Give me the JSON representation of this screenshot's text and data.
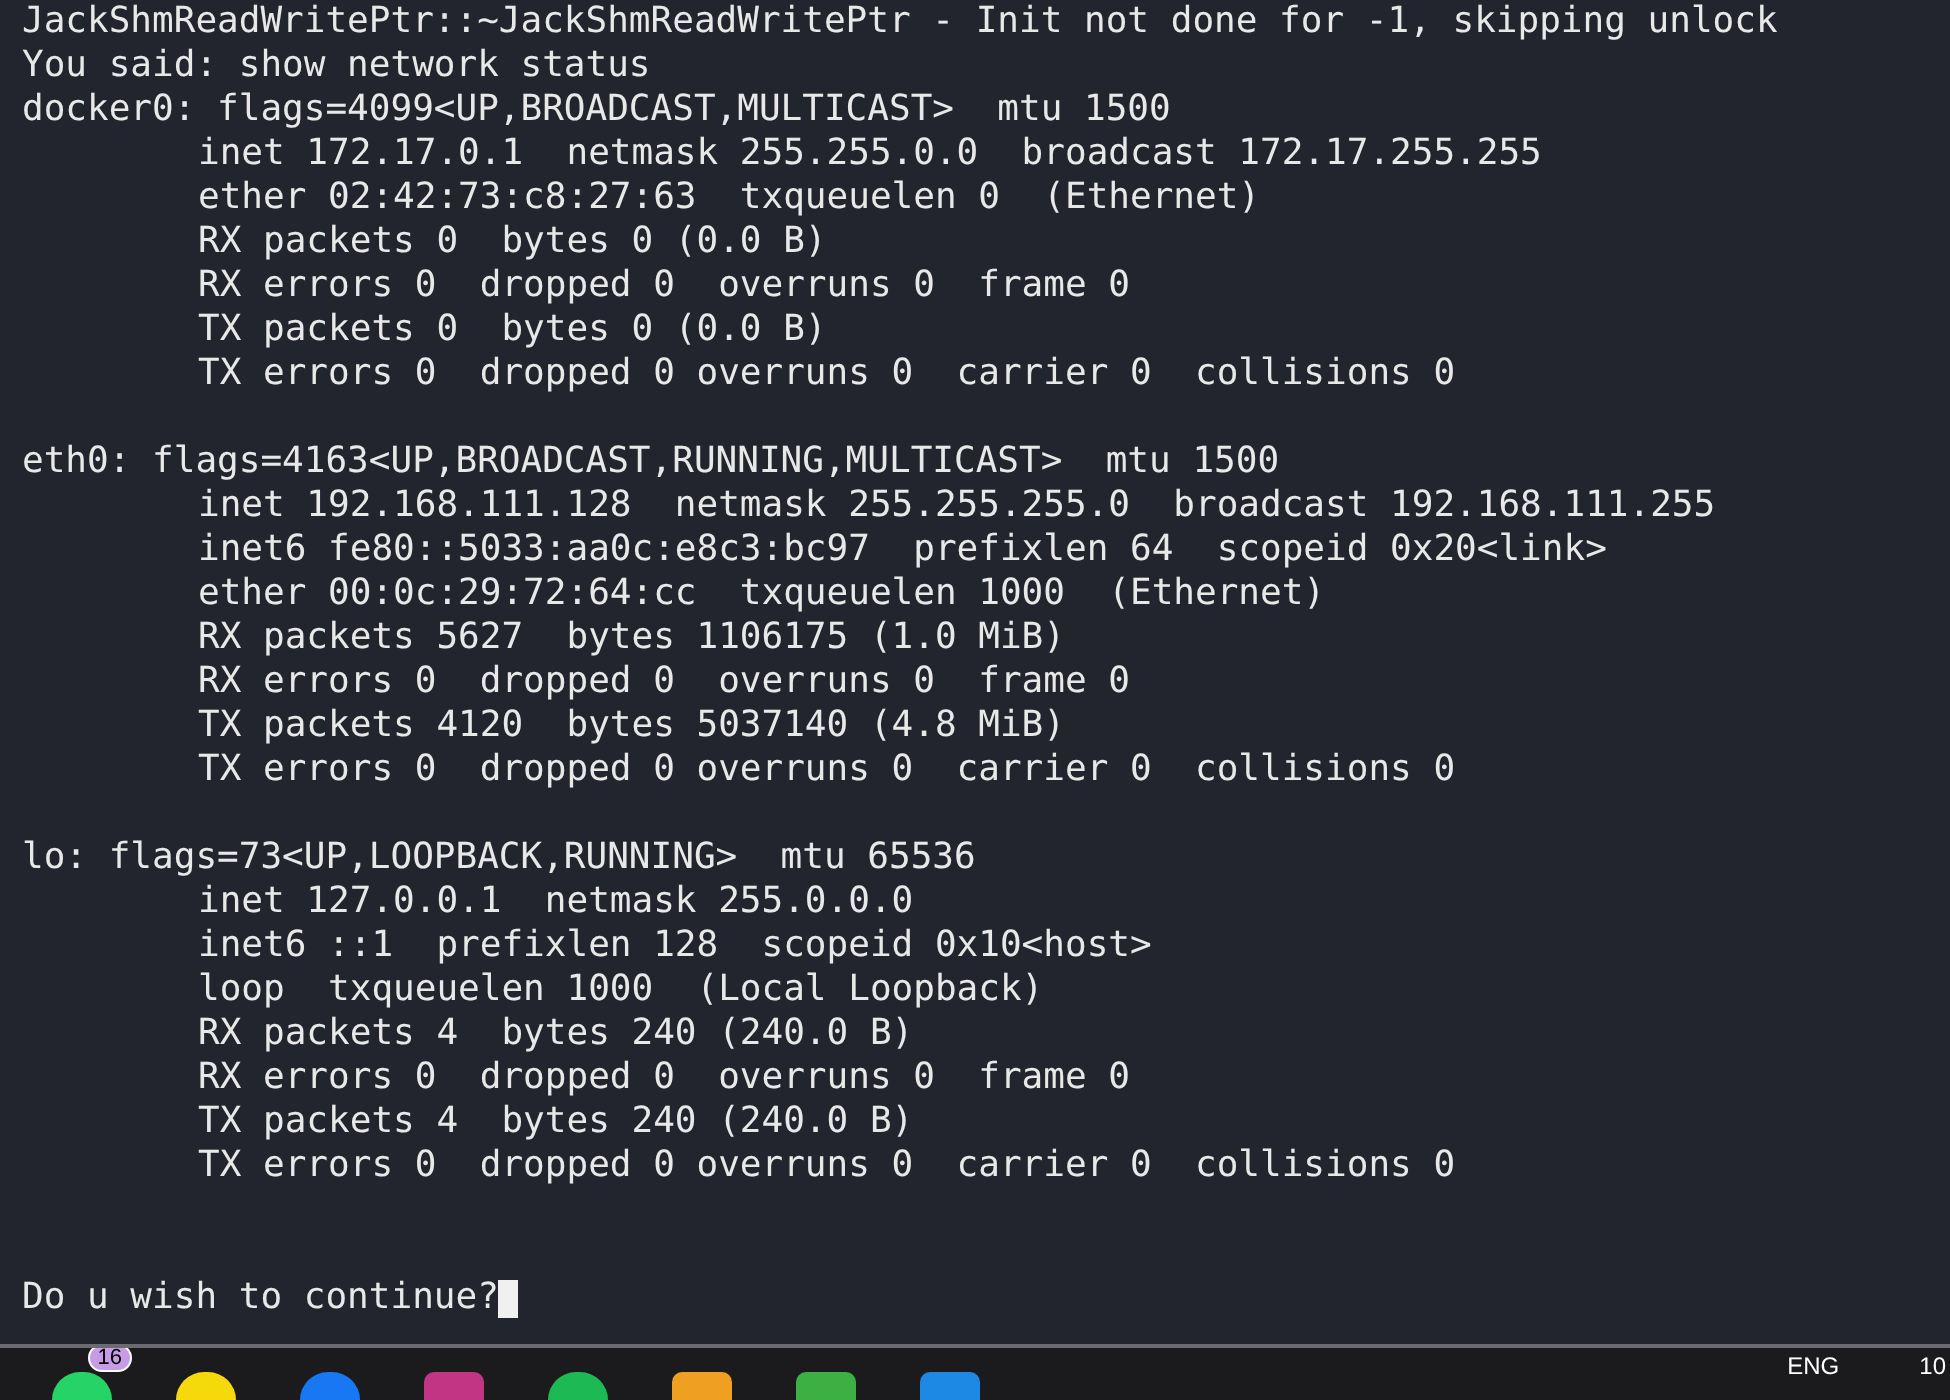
{
  "terminal": {
    "messages": [
      "JackShmReadWritePtr::~JackShmReadWritePtr - Init not done for -1, skipping unlock",
      "You said: show network status"
    ],
    "interfaces": [
      {
        "header": "docker0: flags=4099<UP,BROADCAST,MULTICAST>  mtu 1500",
        "details": [
          "inet 172.17.0.1  netmask 255.255.0.0  broadcast 172.17.255.255",
          "ether 02:42:73:c8:27:63  txqueuelen 0  (Ethernet)",
          "RX packets 0  bytes 0 (0.0 B)",
          "RX errors 0  dropped 0  overruns 0  frame 0",
          "TX packets 0  bytes 0 (0.0 B)",
          "TX errors 0  dropped 0 overruns 0  carrier 0  collisions 0"
        ]
      },
      {
        "header": "eth0: flags=4163<UP,BROADCAST,RUNNING,MULTICAST>  mtu 1500",
        "details": [
          "inet 192.168.111.128  netmask 255.255.255.0  broadcast 192.168.111.255",
          "inet6 fe80::5033:aa0c:e8c3:bc97  prefixlen 64  scopeid 0x20<link>",
          "ether 00:0c:29:72:64:cc  txqueuelen 1000  (Ethernet)",
          "RX packets 5627  bytes 1106175 (1.0 MiB)",
          "RX errors 0  dropped 0  overruns 0  frame 0",
          "TX packets 4120  bytes 5037140 (4.8 MiB)",
          "TX errors 0  dropped 0 overruns 0  carrier 0  collisions 0"
        ]
      },
      {
        "header": "lo: flags=73<UP,LOOPBACK,RUNNING>  mtu 65536",
        "details": [
          "inet 127.0.0.1  netmask 255.0.0.0",
          "inet6 ::1  prefixlen 128  scopeid 0x10<host>",
          "loop  txqueuelen 1000  (Local Loopback)",
          "RX packets 4  bytes 240 (240.0 B)",
          "RX errors 0  dropped 0  overruns 0  frame 0",
          "TX packets 4  bytes 240 (240.0 B)",
          "TX errors 0  dropped 0 overruns 0  carrier 0  collisions 0"
        ]
      }
    ],
    "prompt": "Do u wish to continue?"
  },
  "taskbar": {
    "apps": [
      {
        "kind": "chat",
        "badge": "16",
        "color": "#25d366"
      },
      {
        "kind": "circle",
        "color": "#f5d90a"
      },
      {
        "kind": "circle",
        "color": "#1877f2"
      },
      {
        "kind": "square",
        "color": "#c13584"
      },
      {
        "kind": "circle",
        "color": "#1db954"
      },
      {
        "kind": "square",
        "color": "#f0a020"
      },
      {
        "kind": "square",
        "color": "#3cb043"
      },
      {
        "kind": "square",
        "color": "#1e88e5"
      }
    ],
    "language": "ENG",
    "clock": "10"
  }
}
